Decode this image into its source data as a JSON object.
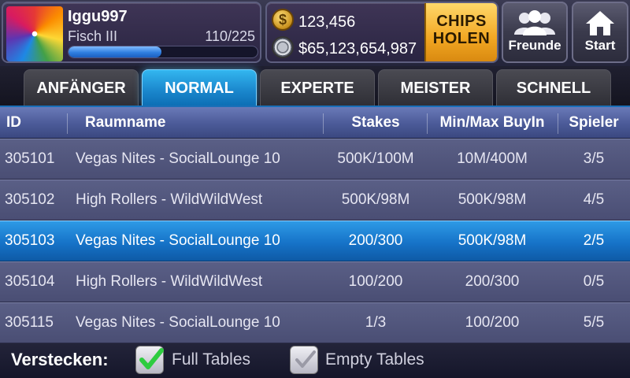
{
  "header": {
    "username": "Iggu997",
    "level_name": "Fisch III",
    "xp_text": "110/225",
    "xp_progress": 0.49,
    "chips": "123,456",
    "cash": "$65,123,654,987",
    "chips_holen_line1": "CHIPS",
    "chips_holen_line2": "HOLEN",
    "friends_label": "Freunde",
    "start_label": "Start",
    "coin_symbol": "$",
    "icons": [
      "avatar",
      "gold-coin-icon",
      "poker-chip-icon",
      "friends-icon",
      "home-icon"
    ]
  },
  "tabs": [
    {
      "label": "ANFÄNGER",
      "active": false
    },
    {
      "label": "NORMAL",
      "active": true
    },
    {
      "label": "EXPERTE",
      "active": false
    },
    {
      "label": "MEISTER",
      "active": false
    },
    {
      "label": "SCHNELL",
      "active": false
    }
  ],
  "table": {
    "columns": [
      "ID",
      "Raumname",
      "Stakes",
      "Min/Max BuyIn",
      "Spieler"
    ],
    "rows": [
      {
        "id": "305101",
        "name": "Vegas Nites - SocialLounge 10",
        "stakes": "500K/100M",
        "buyin": "10M/400M",
        "players": "3/5",
        "selected": false
      },
      {
        "id": "305102",
        "name": "High Rollers - WildWildWest",
        "stakes": "500K/98M",
        "buyin": "500K/98M",
        "players": "4/5",
        "selected": false
      },
      {
        "id": "305103",
        "name": "Vegas Nites - SocialLounge 10",
        "stakes": "200/300",
        "buyin": "500K/98M",
        "players": "2/5",
        "selected": true
      },
      {
        "id": "305104",
        "name": "High Rollers - WildWildWest",
        "stakes": "100/200",
        "buyin": "200/300",
        "players": "0/5",
        "selected": false
      },
      {
        "id": "305115",
        "name": "Vegas Nites - SocialLounge 10",
        "stakes": "1/3",
        "buyin": "100/200",
        "players": "5/5",
        "selected": false
      }
    ]
  },
  "footer": {
    "hide_label": "Verstecken:",
    "full_tables_label": "Full Tables",
    "full_tables_checked": true,
    "empty_tables_label": "Empty Tables",
    "empty_tables_checked": false
  },
  "colors": {
    "accent_blue": "#1a86cc",
    "chips_button": "#f2a723",
    "check_green": "#2ecc40",
    "check_gray": "#9a9aa6"
  }
}
